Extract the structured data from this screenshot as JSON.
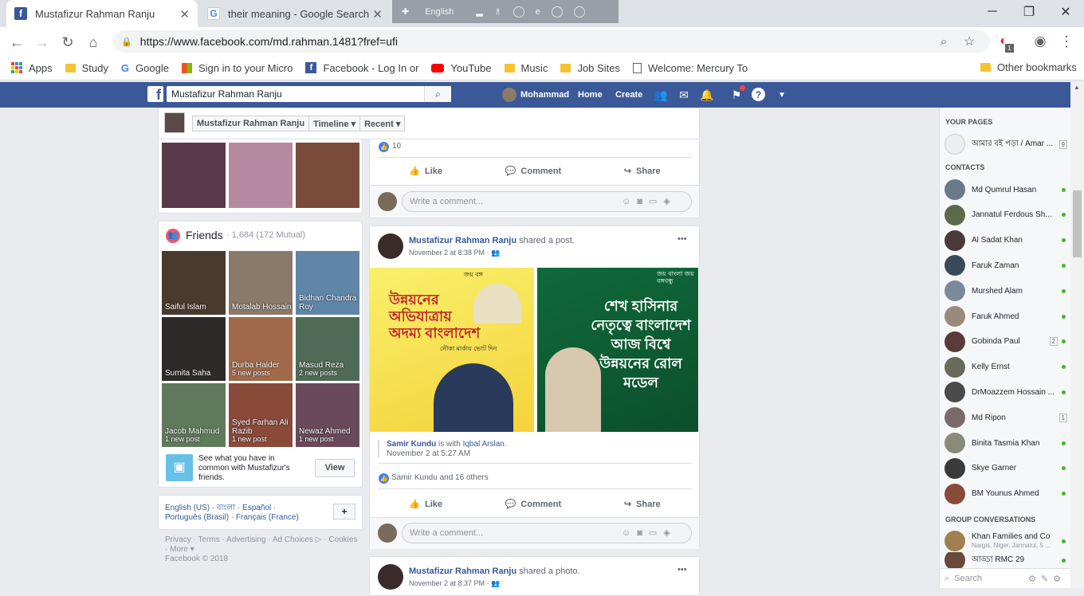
{
  "browser": {
    "tabs": [
      {
        "title": "Mustafizur Rahman Ranju",
        "active": true
      },
      {
        "title": "their meaning - Google Search",
        "active": false
      }
    ],
    "lang_bar": {
      "language": "English"
    },
    "url": "https://www.facebook.com/md.rahman.1481?fref=ufi",
    "extension_badge": "1",
    "bookmarks": [
      "Apps",
      "Study",
      "Google",
      "Sign in to your Micro",
      "Facebook - Log In or",
      "YouTube",
      "Music",
      "Job Sites",
      "Welcome: Mercury To"
    ],
    "other_bookmarks": "Other bookmarks"
  },
  "fb_header": {
    "search_value": "Mustafizur Rahman Ranju",
    "user_name": "Mohammad",
    "home": "Home",
    "create": "Create"
  },
  "profile_nav": {
    "name": "Mustafizur Rahman Ranju",
    "timeline": "Timeline",
    "recent": "Recent"
  },
  "friends": {
    "title": "Friends",
    "count": "· 1,684 (172 Mutual)",
    "list": [
      {
        "name": "Saiful Islam",
        "sub": "",
        "color": "#4a3a2e"
      },
      {
        "name": "Motalab Hossain",
        "sub": "",
        "color": "#8a7a6a"
      },
      {
        "name": "Bidhan Chandra Roy",
        "sub": "",
        "color": "#5f86a8"
      },
      {
        "name": "Sumita Saha",
        "sub": "",
        "color": "#2e2a2a"
      },
      {
        "name": "Durba Halder",
        "sub": "5 new posts",
        "color": "#a06a4a"
      },
      {
        "name": "Masud Reza",
        "sub": "2 new posts",
        "color": "#4f6a56"
      },
      {
        "name": "Jacob Mahmud",
        "sub": "1 new post",
        "color": "#5f7a5a"
      },
      {
        "name": "Syed Farhan Ali Razib",
        "sub": "1 new post",
        "color": "#8a4a3a"
      },
      {
        "name": "Newaz Ahmed",
        "sub": "1 new post",
        "color": "#6a4a5a"
      }
    ],
    "common_text": "See what you have in common with Mustafizur's friends.",
    "view_button": "View"
  },
  "languages": {
    "line1": "English (US) · বাংলা · Español ·",
    "line2": "Português (Brasil) · Français (France)",
    "add": "+"
  },
  "footer": {
    "line1": "Privacy · Terms · Advertising · Ad Choices ▷ · Cookies",
    "line2": "· More ▾",
    "copyright": "Facebook © 2018"
  },
  "post_top": {
    "reactions": "10",
    "like": "Like",
    "comment": "Comment",
    "share": "Share",
    "comment_placeholder": "Write a comment..."
  },
  "post_main": {
    "author": "Mustafizur Rahman Ranju",
    "action": "shared a post.",
    "time": "November 2 at 8:38 PM ·",
    "menu": "•••",
    "poster_left": "উন্নয়নের অভিযাত্রায় অদম্য বাংলাদেশ",
    "poster_left_top": "জয় বঙ্গ",
    "poster_left_vote": "নৌকা মার্কায় ভোট দিন",
    "poster_right": "শেখ হাসিনার নেতৃত্বে বাংলাদেশ আজ বিশ্বে উন্নয়নের রোল মডেল",
    "poster_right_top": "জয় বাংলা জয় বঙ্গবন্ধু",
    "shared_author": "Samir Kundu",
    "shared_with": "is with",
    "shared_tag": "Iqbal Arslan.",
    "shared_time": "November 2 at 5:27 AM",
    "reactions": "Samir Kundu and 16 others",
    "like": "Like",
    "comment": "Comment",
    "share": "Share",
    "comment_placeholder": "Write a comment..."
  },
  "post_bottom": {
    "author": "Mustafizur Rahman Ranju",
    "action": "shared a photo.",
    "time": "November 2 at 8:37 PM ·",
    "menu": "•••"
  },
  "sidebar": {
    "your_pages": "YOUR PAGES",
    "page_name": "আমার বই পড়া / Amar ...",
    "page_count": "9",
    "contacts_title": "CONTACTS",
    "contacts": [
      {
        "name": "Md Qumrul Hasan",
        "badge": ""
      },
      {
        "name": "Jannatul Ferdous Sh...",
        "badge": ""
      },
      {
        "name": "Al Sadat Khan",
        "badge": ""
      },
      {
        "name": "Faruk Zaman",
        "badge": ""
      },
      {
        "name": "Murshed Alam",
        "badge": ""
      },
      {
        "name": "Faruk Ahmed",
        "badge": ""
      },
      {
        "name": "Gobinda Paul",
        "badge": "2"
      },
      {
        "name": "Kelly Ernst",
        "badge": ""
      },
      {
        "name": "DrMoazzem Hossain ...",
        "badge": ""
      },
      {
        "name": "Md Ripon",
        "badge": "1"
      },
      {
        "name": "Binita Tasmia Khan",
        "badge": ""
      },
      {
        "name": "Skye Garner",
        "badge": ""
      },
      {
        "name": "BM Younus Ahmed",
        "badge": ""
      }
    ],
    "group_title": "GROUP CONVERSATIONS",
    "groups": [
      {
        "name": "Khan Families and Co",
        "sub": "Nargis, Niger, Jannatul, 5 ..."
      },
      {
        "name": "আড্ডা RMC 29",
        "sub": ""
      }
    ],
    "search_placeholder": "Search"
  }
}
